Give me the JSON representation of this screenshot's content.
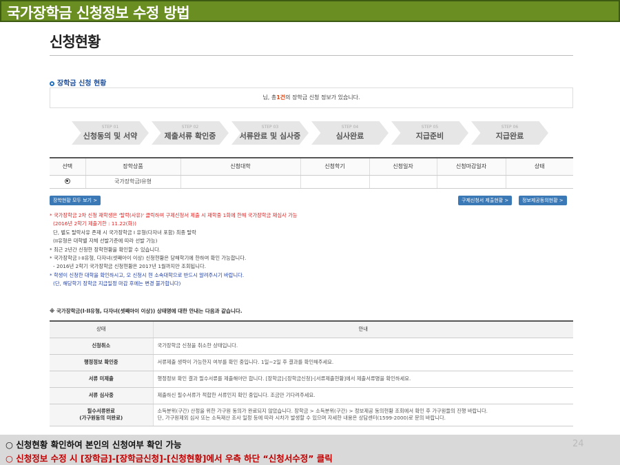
{
  "slide": {
    "title": "국가장학금 신청정보 수정 방법",
    "page_number": "24",
    "footer_line1": "○ 신청현황 확인하여 본인의 신청여부 확인 가능",
    "footer_line2": "○ 신청정보 수정 시 [장학금]-[장학금신청]-[신청현황]에서 우측 하단 “신청서수정” 클릭"
  },
  "screen": {
    "heading": "신청현황",
    "section_title": "장학금 신청 현황",
    "info_pre": "님, 총",
    "info_count": "1건",
    "info_post": "의 장학금 신청 정보가 있습니다.",
    "steps": [
      {
        "label": "STEP 01",
        "name": "신청동의 및 서약"
      },
      {
        "label": "STEP 02",
        "name": "제출서류 확인중"
      },
      {
        "label": "STEP 03",
        "name": "서류완료 및 심사중"
      },
      {
        "label": "STEP 04",
        "name": "심사완료"
      },
      {
        "label": "STEP 05",
        "name": "지급준비"
      },
      {
        "label": "STEP 06",
        "name": "지급완료"
      }
    ],
    "table_headers": [
      "선택",
      "장학상품",
      "신청대학",
      "신청학기",
      "신청일자",
      "신청마감일자",
      "상태"
    ],
    "table_row": {
      "product": "국가장학금I유형",
      "university": "",
      "semester": "",
      "date": "",
      "deadline": "",
      "status": ""
    },
    "btn_all": "장학현황 모두 보기 >",
    "btn_edit": "구제신청서 제출현황 >",
    "btn_consent": "정보제공동의현황 >",
    "notes": {
      "n1": "* 국가장학금 2차 신청 재학생은 '탈락(사유)' 클릭하여 구제신청서 제출 시 재학중 1회에 한해 국가장학금 재심사 가능",
      "n1b": "(2016년 2학기 제출기한 : 11.22(화))",
      "n2": "단, 별도 탈락사유 존재 시 국가장학금 I 유형(다자녀 포함) 최종 탈락",
      "n3": "(II유형은 대학별 자체 선발기준에 따라 선발 가능)",
      "n4": "* 최근 2년간 신청한 장학현황을 확인할 수 있습니다.",
      "n5": "* 국가장학금 I·II유형, 다자녀(셋째아이 이상) 신청현황은 당해학기에 한하여 확인 가능합니다.",
      "n6": "- 2016년 2학기 국가장학금 신청현황은 2017년 1월까지만 조회됩니다.",
      "n7": "* 학생이 신청한 대학을 확인하시고, 오 신청시 현 소속대학으로 반드시 알려주시기 바랍니다.",
      "n8": "(단, 해당학기 장학금 지급일정 마감 후에는 변경 불가합니다)"
    },
    "status_caption": "※ 국가장학금(I·II유형, 다자녀(셋째아이 이상)) 상태명에 대한 안내는 다음과 같습니다.",
    "status_headers": [
      "상태",
      "안내"
    ],
    "status_rows": [
      {
        "state": "신청취소",
        "desc": "국가장학금 신청을 취소한 상태입니다."
      },
      {
        "state": "행정정보 확인중",
        "desc": "서류제출 생략이 가능한지 여부를 확인 중입니다. 1일~2일 후 결과를 확인해주세요."
      },
      {
        "state": "서류 미제출",
        "desc": "행정정보 확인 결과 필수서류를 제출해야만 합니다. [장학금]-[장학금신청]-[서류제출현황]에서 제출서류명을 확인하세요."
      },
      {
        "state": "서류 심사중",
        "desc": "제출하신 필수서류가 적합한 서류인지 확인 중입니다. 조금만 기다려주세요."
      },
      {
        "state": "필수서류완료",
        "state2": "(가구원동의 미완료)",
        "desc": "소득분위(구간) 산정을 위한 가구원 동의가 완료되지 않았습니다. 장학금 > 소득분위(구간) > 정보제공 동의현황 조회에서 확인 후 가구원들의 진행 바랍니다.",
        "desc2": "단, 가구원제외 심사 또는 소득재산 조사 일정 등에 따라 시차가 발생할 수 있으며 자세한 내용은 상담센터(1599-2000)로 문의 바랍니다."
      }
    ]
  }
}
